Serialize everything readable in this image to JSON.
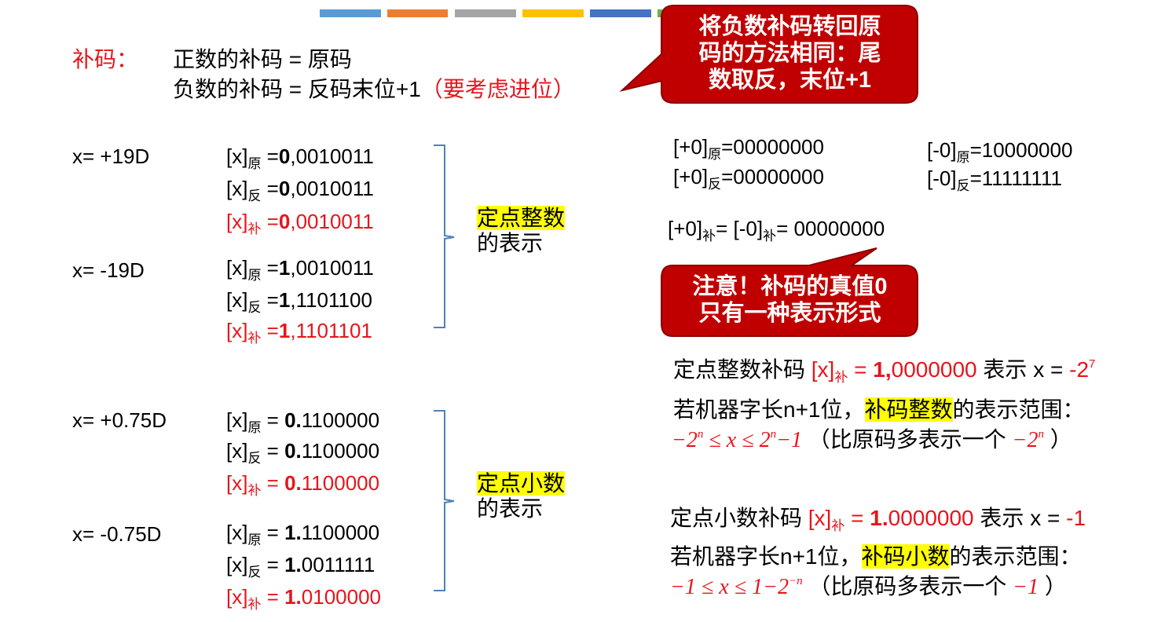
{
  "colors": {
    "accent_red": "#e8141c",
    "callout_fill": "#c00000",
    "highlight": "#ffff00",
    "bracket": "#4f81bd",
    "top_bars": [
      "#5b9bd5",
      "#ed7d31",
      "#a5a5a5",
      "#ffc000",
      "#4472c4",
      "#70ad47"
    ]
  },
  "header": {
    "term": "补码：",
    "line1": "正数的补码 = 原码",
    "line2_main": "负数的补码 = 反码末位+1",
    "line2_note": "（要考虑进位）"
  },
  "callout_top": {
    "text1": "将负数补码转回原",
    "text2": "码的方法相同：尾",
    "text3": "数取反，末位+1"
  },
  "callout_mid": {
    "text1": "注意！补码的真值0",
    "text2": "只有一种表示形式"
  },
  "sub": {
    "yuan": "原",
    "fan": "反",
    "bu": "补"
  },
  "int_group": {
    "label_hl": "定点整数",
    "label_rest": "的表示",
    "x_pos": "x= +19D",
    "pos_yuan": {
      "prefix": "[x]",
      "eq": " =",
      "bold": "0",
      "rest": ",0010011"
    },
    "pos_fan": {
      "prefix": "[x]",
      "eq": " =",
      "bold": "0",
      "rest": ",0010011"
    },
    "pos_bu": {
      "prefix": "[x]",
      "eq": " =",
      "bold": "0",
      "rest": ",0010011"
    },
    "x_neg": "x= -19D",
    "neg_yuan": {
      "prefix": "[x]",
      "eq": " =",
      "bold": "1",
      "rest": ",0010011"
    },
    "neg_fan": {
      "prefix": "[x]",
      "eq": " =",
      "bold": "1",
      "rest": ",1101100"
    },
    "neg_bu": {
      "prefix": "[x]",
      "eq": " =",
      "bold": "1",
      "rest": ",1101101"
    }
  },
  "frac_group": {
    "label_hl": "定点小数",
    "label_rest": "的表示",
    "x_pos": "x= +0.75D",
    "pos_yuan": {
      "prefix": "[x]",
      "eq": " = ",
      "bold": "0.",
      "rest": "1100000"
    },
    "pos_fan": {
      "prefix": "[x]",
      "eq": " = ",
      "bold": "0.",
      "rest": "1100000"
    },
    "pos_bu": {
      "prefix": "[x]",
      "eq": " = ",
      "bold": "0.",
      "rest": "1100000"
    },
    "x_neg": "x= -0.75D",
    "neg_yuan": {
      "prefix": "[x]",
      "eq": " = ",
      "bold": "1.",
      "rest": "1100000"
    },
    "neg_fan": {
      "prefix": "[x]",
      "eq": " = ",
      "bold": "1.",
      "rest": "0011111"
    },
    "neg_bu": {
      "prefix": "[x]",
      "eq": " = ",
      "bold": "1.",
      "rest": "0100000"
    }
  },
  "zero": {
    "p0_yuan": {
      "pre": "[+0]",
      "val": "=00000000"
    },
    "p0_fan": {
      "pre": "[+0]",
      "val": "=00000000"
    },
    "n0_yuan": {
      "pre": "[-0]",
      "val": "=10000000"
    },
    "n0_fan": {
      "pre": "[-0]",
      "val": "=11111111"
    },
    "bu_pre1": "[+0]",
    "bu_mid": "= [-0]",
    "bu_val": "= 00000000"
  },
  "int_range": {
    "l1_a": "定点整数补码 ",
    "l1_x": "[x]",
    "l1_eq": " = ",
    "l1_bold": "1,",
    "l1_rest": "0000000",
    "l1_b": " 表示 x = ",
    "l1_val": "-2",
    "l1_exp": "7",
    "l2_a": "若机器字长n+1位，",
    "l2_hl": "补码整数",
    "l2_b": "的表示范围：",
    "l3_lo": "−2",
    "l3_lo_exp": "n",
    "l3_le": "  ≤ x ≤ ",
    "l3_hi": "2",
    "l3_hi_exp": "n",
    "l3_hi_rest": "−1",
    "l3_note": " （比原码多表示一个 ",
    "l3_extra": "−2",
    "l3_extra_exp": "n",
    "l3_close": " ）"
  },
  "frac_range": {
    "l1_a": "定点小数补码 ",
    "l1_x": "[x]",
    "l1_eq": " = ",
    "l1_bold": "1.",
    "l1_rest": "0000000",
    "l1_b": " 表示 x = ",
    "l1_val": "-1",
    "l2_a": "若机器字长n+1位，",
    "l2_hl": "补码小数",
    "l2_b": "的表示范围：",
    "l3_lo": "−1",
    "l3_le": "  ≤ x ≤ ",
    "l3_hi": "1−2",
    "l3_hi_exp": "−n",
    "l3_note": " （比原码多表示一个 ",
    "l3_extra": "−1",
    "l3_close": " ）"
  }
}
